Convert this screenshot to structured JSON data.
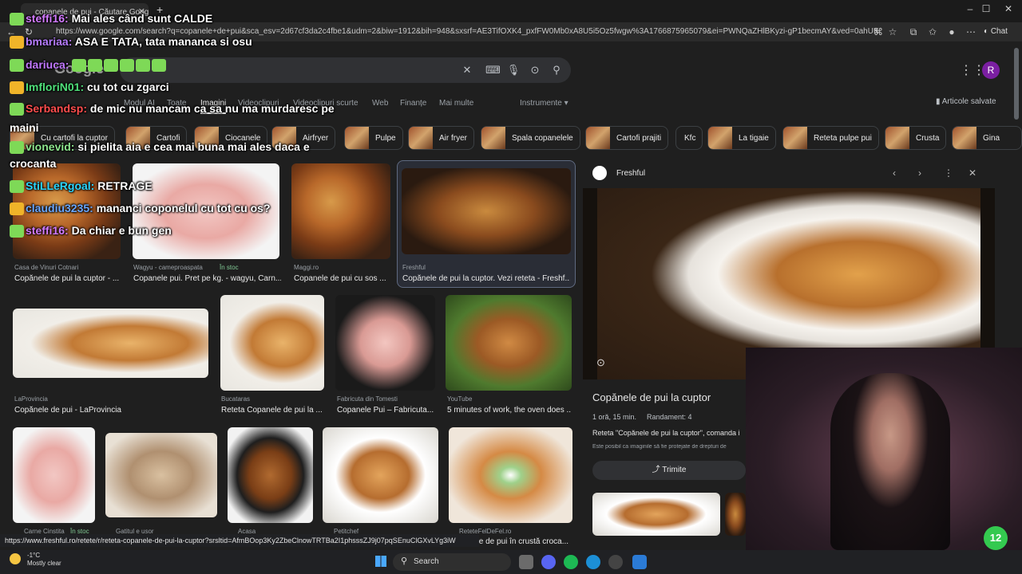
{
  "browser": {
    "tab_title": "copanele de pui - Căutare Google",
    "url": "https://www.google.com/search?q=copanele+de+pui&sca_esv=2d67cf3da2c4fbe1&udm=2&biw=1912&bih=948&sxsrf=AE3TifOXK4_pxfFW0Mb0xA8U5i5Oz5fwgw%3A1766875965079&ei=PWNQaZHlBKyzi-gP1becmAY&ved=0ahUKEwjR2ory7...",
    "chat_label": "Chat"
  },
  "google": {
    "logo": "Google",
    "avatar_letter": "R",
    "nav_tabs": [
      "Modul AI",
      "Toate",
      "Imagini",
      "Videoclipuri",
      "Videoclipuri scurte",
      "Web",
      "Finanțe",
      "Mai multe"
    ],
    "active_tab": "Imagini",
    "tools": "Instrumente",
    "saved": "Articole salvate",
    "chips": [
      "Cu cartofi la cuptor",
      "Cartofi",
      "Ciocanele",
      "Airfryer",
      "Pulpe",
      "Air fryer",
      "Spala copanelele",
      "Cartofi prajiti",
      "Kfc",
      "La tigaie",
      "Reteta pulpe pui",
      "Crusta",
      "Gina"
    ]
  },
  "results": {
    "row1": [
      {
        "source": "Casa de Vinuri Cotnari",
        "caption": "Copănele de pui la cuptor - ..."
      },
      {
        "source": "Wagyu - cameproaspata",
        "stock": "În stoc",
        "caption": "Copanele pui. Pret pe kg. - wagyu, Carn..."
      },
      {
        "source": "Maggi.ro",
        "caption": "Copanele de pui cu sos ..."
      },
      {
        "source": "Freshful",
        "caption": "Copănele de pui la cuptor. Vezi reteta - Freshf..."
      }
    ],
    "row2": [
      {
        "source": "LaProvincia",
        "caption": "Copănele de pui - LaProvincia"
      },
      {
        "source": "Bucataras",
        "caption": "Reteta Copanele de pui la ..."
      },
      {
        "source": "Fabricuta din Tomesti",
        "caption": "Copanele Pui – Fabricuta..."
      },
      {
        "source": "YouTube",
        "caption": "5 minutes of work, the oven does ..."
      }
    ],
    "row3": [
      {
        "source": "Carne Cinstita",
        "stock": "În stoc"
      },
      {
        "source": "Gatitul e usor"
      },
      {
        "source": "Acasa"
      },
      {
        "source": "Petitchef"
      },
      {
        "source": "ReteteFelDeFel.ro",
        "caption": "ele de pui în crustă croca..."
      }
    ]
  },
  "preview": {
    "source": "Freshful",
    "title": "Copănele de pui la cuptor",
    "time": "1 oră, 15 min.",
    "servings": "Randament: 4",
    "desc": "Reteta \"Copănele de pui la cuptor\", comanda i",
    "note": "Este posibil ca imaginile să fie protejate de drepturi de",
    "share": "Trimite"
  },
  "chat": [
    {
      "user": "steffi16:",
      "msg": "Mai ales când sunt CALDE"
    },
    {
      "user": "bmariaa:",
      "msg": "ASA E TATA, tata mananca si osu"
    },
    {
      "user": "dariuca:",
      "msg": ""
    },
    {
      "user": "ImfloriN01:",
      "msg": "cu tot cu zgarci"
    },
    {
      "user": "Serbandsp:",
      "msg": "de mic nu mancam ca sa nu ma murdaresc pe"
    },
    {
      "user": "",
      "msg": "maini"
    },
    {
      "user": "vionevid:",
      "msg": "si pielita aia e cea mai buna mai ales daca e"
    },
    {
      "user": "",
      "msg": "crocanta"
    },
    {
      "user": "StiLLeRgoal:",
      "msg": "RETRAGE"
    },
    {
      "user": "claudiu3235:",
      "msg": "mananci coponelul cu tot cu os?"
    },
    {
      "user": "steffi16:",
      "msg": "Da chiar e bun gen"
    }
  ],
  "status_url": "https://www.freshful.ro/retete/r/reteta-copanele-de-pui-la-cuptor?srsltid=AfmBOop3Ky2ZbeClnowTRTBa2I1phsssZJ9j07pqSEnuClGXvLYg3iW",
  "taskbar": {
    "temp": "-1°C",
    "weather": "Mostly clear",
    "search": "Search",
    "badge": "12"
  }
}
